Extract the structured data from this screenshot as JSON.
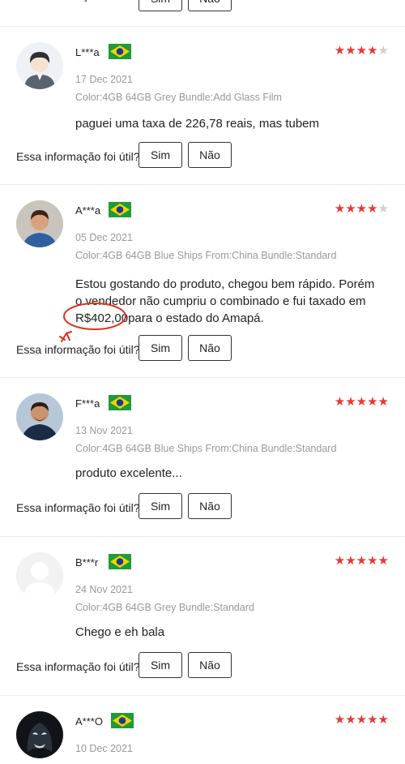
{
  "helpful_question": "Essa informação foi útil?",
  "yes_label": "Sim",
  "no_label": "Não",
  "reviews": [
    {
      "user": "L***a",
      "rating": 4,
      "date": "17 Dec 2021",
      "specs": "Color:4GB 64GB Grey Bundle:Add Glass Film",
      "text": "paguei uma taxa de 226,78 reais, mas tubem"
    },
    {
      "user": "A***a",
      "rating": 4,
      "date": "05 Dec 2021",
      "specs": "Color:4GB 64GB Blue Ships From:China Bundle:Standard",
      "text_parts": {
        "line1": "Estou gostando do produto, chegou bem rápido. Porém",
        "line2": "o vendedor não cumpriu o combinado e fui taxado em",
        "amount": "R$402,00",
        "line3_rest": "para o estado do Amapá."
      }
    },
    {
      "user": "F***a",
      "rating": 5,
      "date": "13 Nov 2021",
      "specs": "Color:4GB 64GB Blue Ships From:China Bundle:Standard",
      "text": "produto excelente..."
    },
    {
      "user": "B***r",
      "rating": 5,
      "date": "24 Nov 2021",
      "specs": "Color:4GB 64GB Grey Bundle:Standard",
      "text": "Chego e eh bala"
    },
    {
      "user": "A***O",
      "rating": 5,
      "date": "10 Dec 2021"
    }
  ],
  "colors": {
    "star": "#e53935",
    "star_off": "#cfcfcf",
    "annotation": "#e0311b",
    "flag_green": "#1e9b3a",
    "flag_yellow": "#f5d300",
    "flag_blue": "#1f3a8a"
  }
}
